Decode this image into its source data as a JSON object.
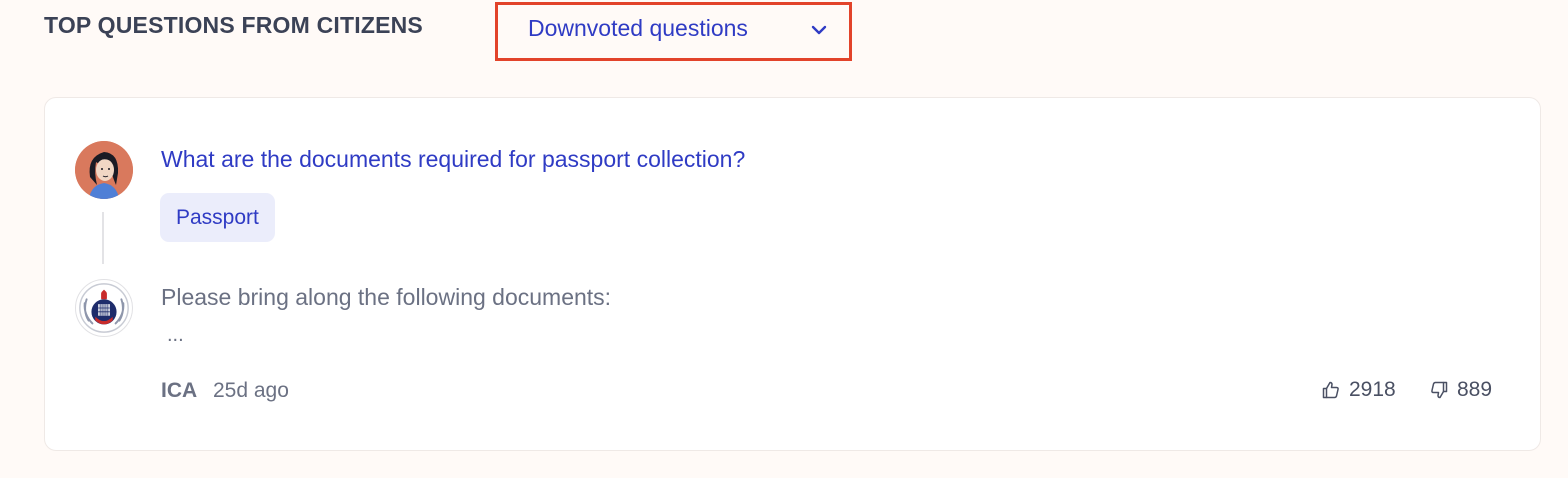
{
  "section": {
    "title": "TOP QUESTIONS FROM CITIZENS"
  },
  "filter": {
    "selected": "Downvoted questions",
    "icon": "chevron-down-icon"
  },
  "question_card": {
    "question": "What are the documents required for passport collection?",
    "tag": "Passport",
    "answer_preview": "Please bring along the following documents:",
    "ellipsis": "...",
    "author": "ICA",
    "time": "25d ago",
    "upvotes": "2918",
    "downvotes": "889",
    "avatar_icon": "user-avatar-icon",
    "org_icon": "ica-logo-icon"
  },
  "colors": {
    "accent": "#2f3bc4",
    "highlight_border": "#e2432a",
    "background": "#fffaf7",
    "avatar_bg": "#d9795d"
  }
}
